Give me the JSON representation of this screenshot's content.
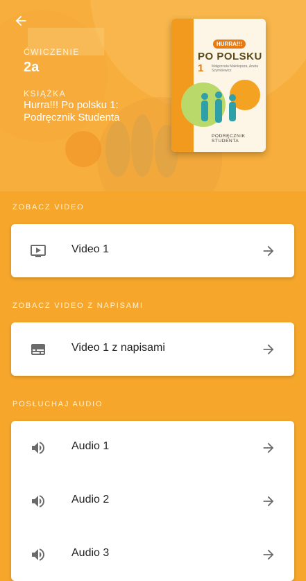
{
  "header": {
    "exercise_label": "ĆWICZENIE",
    "exercise_value": "2a",
    "book_label": "KSIĄŻKA",
    "book_value": "Hurra!!! Po polsku 1: Podręcznik Studenta",
    "back_icon": "arrow-left-icon"
  },
  "cover": {
    "logo": "HURRA!!!",
    "title": "PO POLSKU",
    "number": "1",
    "authors": "Małgorzata Małolepsza, Aneta Szymkiewicz",
    "subtitle": "PODRĘCZNIK STUDENTA"
  },
  "sections": [
    {
      "label": "ZOBACZ VIDEO",
      "items": [
        {
          "label": "Video 1",
          "icon": "video-play-icon"
        }
      ]
    },
    {
      "label": "ZOBACZ VIDEO Z NAPISAMI",
      "items": [
        {
          "label": "Video 1 z napisami",
          "icon": "subtitles-icon"
        }
      ]
    },
    {
      "label": "POSŁUCHAJ AUDIO",
      "items": [
        {
          "label": "Audio 1",
          "icon": "speaker-icon"
        },
        {
          "label": "Audio 2",
          "icon": "speaker-icon"
        },
        {
          "label": "Audio 3",
          "icon": "speaker-icon"
        }
      ]
    }
  ],
  "colors": {
    "background": "#F5A62B",
    "header_background": "#F7AE3C",
    "card": "#FFFFFF",
    "icon": "#6B6B6B"
  }
}
